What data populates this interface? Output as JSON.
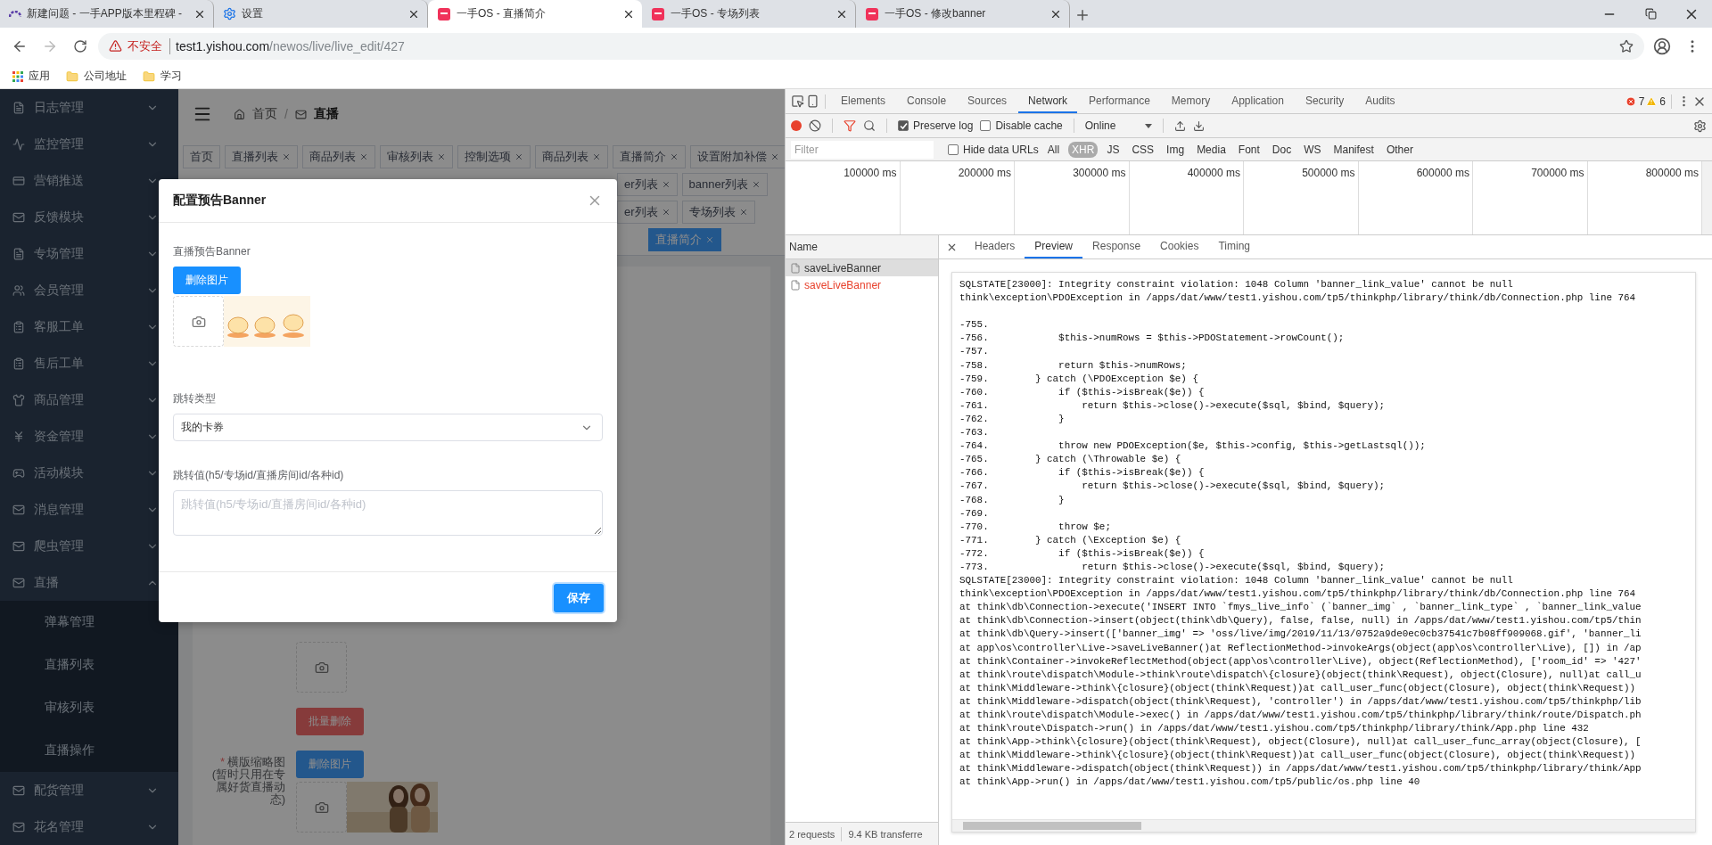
{
  "browser": {
    "tabs": [
      {
        "title": "新建问题 - 一手APP版本里程碑 -",
        "selected": false
      },
      {
        "title": "设置",
        "selected": false
      },
      {
        "title": "一手OS - 直播简介",
        "selected": true
      },
      {
        "title": "一手OS - 专场列表",
        "selected": false
      },
      {
        "title": "一手OS - 修改banner",
        "selected": false
      }
    ],
    "address": {
      "security": "不安全",
      "host": "test1.yishou.com",
      "path": "/newos/live/live_edit/427"
    },
    "bookmarks": [
      "应用",
      "公司地址",
      "学习"
    ]
  },
  "sidebar": {
    "items": [
      {
        "label": "日志管理",
        "expanded": false
      },
      {
        "label": "监控管理",
        "expanded": false
      },
      {
        "label": "营销推送",
        "expanded": false
      },
      {
        "label": "反馈模块",
        "expanded": false
      },
      {
        "label": "专场管理",
        "expanded": false
      },
      {
        "label": "会员管理",
        "expanded": false
      },
      {
        "label": "客服工单",
        "expanded": false
      },
      {
        "label": "售后工单",
        "expanded": false
      },
      {
        "label": "商品管理",
        "expanded": false
      },
      {
        "label": "资金管理",
        "expanded": false
      },
      {
        "label": "活动模块",
        "expanded": false
      },
      {
        "label": "消息管理",
        "expanded": false
      },
      {
        "label": "爬虫管理",
        "expanded": false
      },
      {
        "label": "直播",
        "expanded": true,
        "children": [
          {
            "label": "弹幕管理"
          },
          {
            "label": "直播列表"
          },
          {
            "label": "审核列表"
          },
          {
            "label": "直播操作"
          }
        ]
      },
      {
        "label": "配货管理",
        "expanded": false
      },
      {
        "label": "花名管理",
        "expanded": false
      }
    ]
  },
  "header": {
    "breadcrumb": [
      "首页",
      "直播"
    ],
    "separator": "/"
  },
  "tag_rows": [
    {
      "tags": [
        {
          "label": "首页",
          "closable": false,
          "selected": false
        },
        {
          "label": "直播列表",
          "closable": true,
          "selected": false
        },
        {
          "label": "商品列表",
          "closable": true,
          "selected": false
        },
        {
          "label": "审核列表",
          "closable": true,
          "selected": false
        },
        {
          "label": "控制选项",
          "closable": true,
          "selected": false
        },
        {
          "label": "商品列表",
          "closable": true,
          "selected": false
        },
        {
          "label": "直播简介",
          "closable": true,
          "selected": false
        },
        {
          "label": "设置附加补偿",
          "closable": true,
          "selected": false
        }
      ]
    },
    {
      "tags": [
        {
          "label": "er列表",
          "closable": true,
          "selected": false
        },
        {
          "label": "banner列表",
          "closable": true,
          "selected": false
        }
      ]
    },
    {
      "tags": [
        {
          "label": "er列表",
          "closable": true,
          "selected": false
        },
        {
          "label": "专场列表",
          "closable": true,
          "selected": false
        }
      ]
    },
    {
      "tags": [
        {
          "label": "直播简介",
          "closable": true,
          "selected": true
        }
      ]
    }
  ],
  "background_form": {
    "batch_delete": "批量删除",
    "thumb_label": "横版缩略图(暂时只用在专属好货直播动态)",
    "required_mark": "*",
    "delete_button": "删除图片"
  },
  "modal": {
    "title": "配置预告Banner",
    "banner_label": "直播预告Banner",
    "delete_button": "删除图片",
    "jump_type": {
      "label": "跳转类型",
      "value": "我的卡券"
    },
    "jump_value": {
      "label": "跳转值(h5/专场id/直播房间id/各种id)",
      "placeholder": "跳转值(h5/专场id/直播房间id/各种id)"
    },
    "save_button": "保存"
  },
  "devtools": {
    "tabs": [
      {
        "label": "Elements",
        "selected": false
      },
      {
        "label": "Console",
        "selected": false
      },
      {
        "label": "Sources",
        "selected": false
      },
      {
        "label": "Network",
        "selected": true
      },
      {
        "label": "Performance",
        "selected": false
      },
      {
        "label": "Memory",
        "selected": false
      },
      {
        "label": "Application",
        "selected": false
      },
      {
        "label": "Security",
        "selected": false
      },
      {
        "label": "Audits",
        "selected": false
      }
    ],
    "errors": "7",
    "warnings": "6",
    "toolbar": {
      "recording": true,
      "filter_active": true,
      "preserve_log": {
        "label": "Preserve log",
        "checked": true
      },
      "disable_cache": {
        "label": "Disable cache",
        "checked": false
      },
      "throttle": "Online"
    },
    "filter": {
      "placeholder": "Filter",
      "hide_data_urls": {
        "label": "Hide data URLs",
        "checked": false
      },
      "types": [
        {
          "label": "All",
          "selected": false
        },
        {
          "label": "XHR",
          "selected": true
        },
        {
          "label": "JS",
          "selected": false
        },
        {
          "label": "CSS",
          "selected": false
        },
        {
          "label": "Img",
          "selected": false
        },
        {
          "label": "Media",
          "selected": false
        },
        {
          "label": "Font",
          "selected": false
        },
        {
          "label": "Doc",
          "selected": false
        },
        {
          "label": "WS",
          "selected": false
        },
        {
          "label": "Manifest",
          "selected": false
        },
        {
          "label": "Other",
          "selected": false
        }
      ]
    },
    "timeline_ticks": [
      "100000 ms",
      "200000 ms",
      "300000 ms",
      "400000 ms",
      "500000 ms",
      "600000 ms",
      "700000 ms",
      "800000 ms"
    ],
    "name_header": "Name",
    "requests": [
      {
        "name": "saveLiveBanner",
        "selected": true,
        "failed": false
      },
      {
        "name": "saveLiveBanner",
        "selected": false,
        "failed": true
      }
    ],
    "status": [
      "2 requests",
      "9.4 KB transferre"
    ],
    "detail_tabs": [
      {
        "label": "Headers",
        "selected": false
      },
      {
        "label": "Preview",
        "selected": true
      },
      {
        "label": "Response",
        "selected": false
      },
      {
        "label": "Cookies",
        "selected": false
      },
      {
        "label": "Timing",
        "selected": false
      }
    ],
    "preview": {
      "head": [
        "SQLSTATE[23000]: Integrity constraint violation: 1048 Column 'banner_link_value' cannot be null",
        "think\\exception\\PDOException in /apps/dat/www/test1.yishou.com/tp5/thinkphp/library/think/db/Connection.php line 764"
      ],
      "lines": [
        "-755.",
        "-756.            $this->numRows = $this->PDOStatement->rowCount();",
        "-757.",
        "-758.            return $this->numRows;",
        "-759.        } catch (\\PDOException $e) {",
        "-760.            if ($this->isBreak($e)) {",
        "-761.                return $this->close()->execute($sql, $bind, $query);",
        "-762.            }",
        "-763.",
        "-764.            throw new PDOException($e, $this->config, $this->getLastsql());",
        "-765.        } catch (\\Throwable $e) {",
        "-766.            if ($this->isBreak($e)) {",
        "-767.                return $this->close()->execute($sql, $bind, $query);",
        "-768.            }",
        "-769.",
        "-770.            throw $e;",
        "-771.        } catch (\\Exception $e) {",
        "-772.            if ($this->isBreak($e)) {",
        "-773.                return $this->close()->execute($sql, $bind, $query);",
        "SQLSTATE[23000]: Integrity constraint violation: 1048 Column 'banner_link_value' cannot be null",
        "think\\exception\\PDOException in /apps/dat/www/test1.yishou.com/tp5/thinkphp/library/think/db/Connection.php line 764",
        "at think\\db\\Connection->execute('INSERT INTO `fmys_live_info` (`banner_img` , `banner_link_type` , `banner_link_value",
        "at think\\db\\Connection->insert(object(think\\db\\Query), false, false, null) in /apps/dat/www/test1.yishou.com/tp5/thin",
        "at think\\db\\Query->insert(['banner_img' => 'oss/live/img/2019/11/13/0752a9de0ec0cb37541c7b08ff909068.gif', 'banner_li",
        "at app\\os\\controller\\Live->saveLiveBanner()at ReflectionMethod->invokeArgs(object(app\\os\\controller\\Live), []) in /ap",
        "at think\\Container->invokeReflectMethod(object(app\\os\\controller\\Live), object(ReflectionMethod), ['room_id' => '427'",
        "at think\\route\\dispatch\\Module->think\\route\\dispatch\\{closure}(object(think\\Request), object(Closure), null)at call_u",
        "at think\\Middleware->think\\{closure}(object(think\\Request))at call_user_func(object(Closure), object(think\\Request))",
        "at think\\Middleware->dispatch(object(think\\Request), 'controller') in /apps/dat/www/test1.yishou.com/tp5/thinkphp/lib",
        "at think\\route\\dispatch\\Module->exec() in /apps/dat/www/test1.yishou.com/tp5/thinkphp/library/think/route/Dispatch.ph",
        "at think\\route\\Dispatch->run() in /apps/dat/www/test1.yishou.com/tp5/thinkphp/library/think/App.php line 432",
        "at think\\App->think\\{closure}(object(think\\Request), object(Closure), null)at call_user_func_array(object(Closure), [",
        "at think\\Middleware->think\\{closure}(object(think\\Request))at call_user_func(object(Closure), object(think\\Request))",
        "at think\\Middleware->dispatch(object(think\\Request)) in /apps/dat/www/test1.yishou.com/tp5/thinkphp/library/think/App",
        "at think\\App->run() in /apps/dat/www/test1.yishou.com/tp5/public/os.php line 40"
      ]
    }
  }
}
